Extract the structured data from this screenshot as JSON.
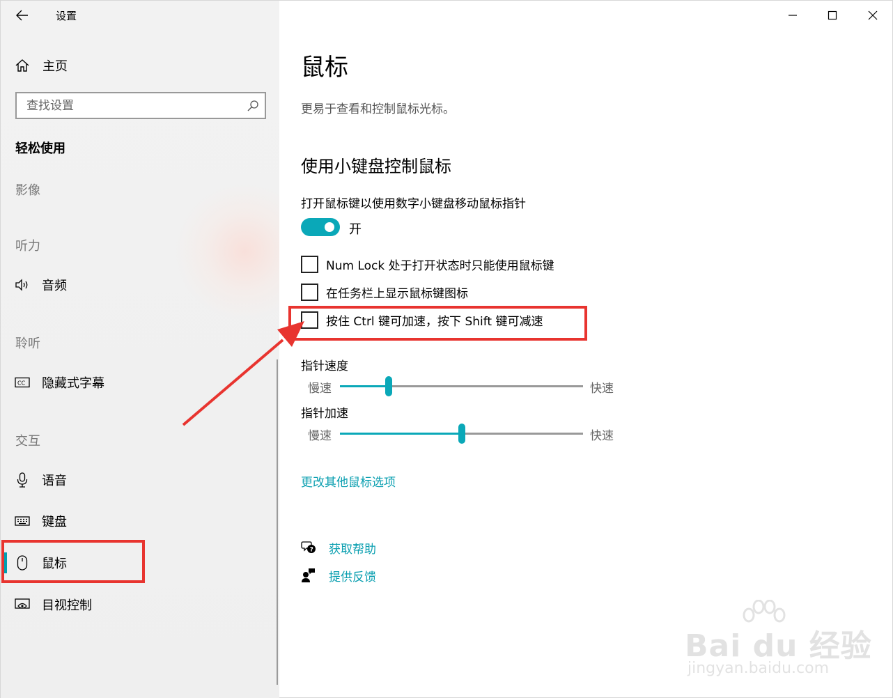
{
  "app": {
    "title": "设置"
  },
  "sidebar": {
    "home_label": "主页",
    "search_placeholder": "查找设置",
    "section": "轻松使用",
    "groups": {
      "vision": "影像",
      "hearing": "听力",
      "listening": "聆听",
      "interaction": "交互"
    },
    "items": {
      "audio": "音频",
      "captions": "隐藏式字幕",
      "speech": "语音",
      "keyboard": "键盘",
      "mouse": "鼠标",
      "eye_control": "目视控制"
    }
  },
  "main": {
    "title": "鼠标",
    "description": "更易于查看和控制鼠标光标。",
    "subtitle": "使用小键盘控制鼠标",
    "toggle_description": "打开鼠标键以使用数字小键盘移动鼠标指针",
    "toggle_state": "开",
    "toggle_on": true,
    "checkboxes": [
      {
        "label": "Num Lock 处于打开状态时只能使用鼠标键",
        "checked": false
      },
      {
        "label": "在任务栏上显示鼠标键图标",
        "checked": false
      },
      {
        "label": "按住 Ctrl 键可加速，按下 Shift 键可减速",
        "checked": false
      }
    ],
    "sliders": [
      {
        "title": "指针速度",
        "min_label": "慢速",
        "max_label": "快速",
        "value": 0.2
      },
      {
        "title": "指针加速",
        "min_label": "慢速",
        "max_label": "快速",
        "value": 0.5
      }
    ],
    "more_link": "更改其他鼠标选项",
    "help_link": "获取帮助",
    "feedback_link": "提供反馈"
  },
  "watermark": {
    "main": "Bai du 经验",
    "sub": "jingyan.baidu.com"
  },
  "colors": {
    "accent": "#0aa8b8",
    "annotation": "#e8342f"
  }
}
